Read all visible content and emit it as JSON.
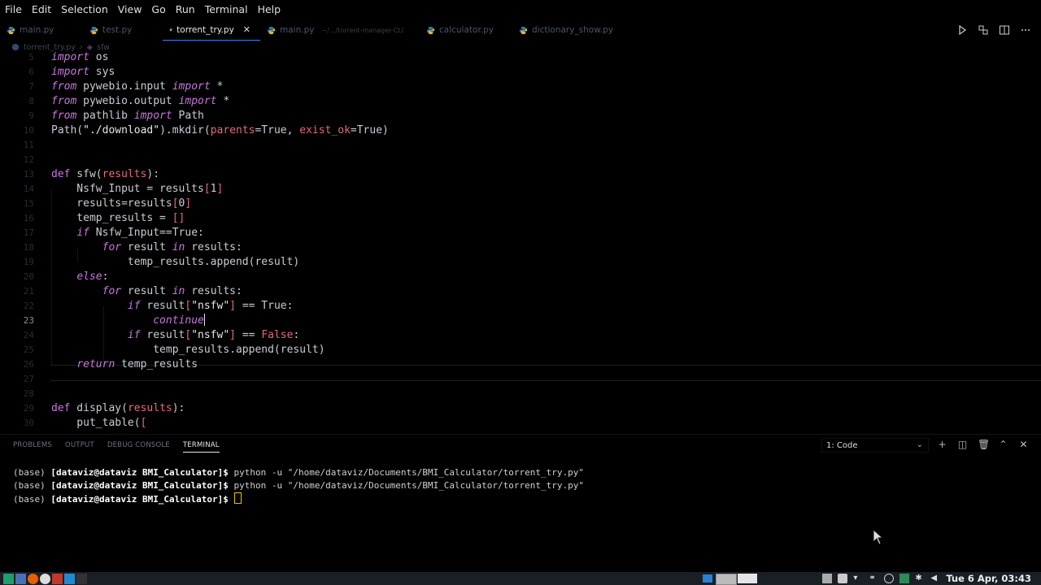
{
  "menu": [
    "File",
    "Edit",
    "Selection",
    "View",
    "Go",
    "Run",
    "Terminal",
    "Help"
  ],
  "tabs": [
    {
      "label": "main.py",
      "desc": "",
      "active": false
    },
    {
      "label": "test.py",
      "desc": "",
      "active": false
    },
    {
      "label": "torrent_try.py",
      "desc": "",
      "active": true
    },
    {
      "label": "main.py",
      "desc": "~/.../torrent-manager-CLI",
      "active": false
    },
    {
      "label": "calculator.py",
      "desc": "",
      "active": false
    },
    {
      "label": "dictionary_show.py",
      "desc": "",
      "active": false
    }
  ],
  "breadcrumb": {
    "file": "torrent_try.py",
    "symbol": "sfw"
  },
  "editor": {
    "current_line": "23",
    "line_numbers": [
      "5",
      "6",
      "7",
      "8",
      "9",
      "10",
      "11",
      "12",
      "13",
      "14",
      "15",
      "16",
      "17",
      "18",
      "19",
      "20",
      "21",
      "22",
      "23",
      "24",
      "25",
      "26",
      "27",
      "28",
      "29",
      "30"
    ]
  },
  "panel": {
    "tabs": [
      "PROBLEMS",
      "OUTPUT",
      "DEBUG CONSOLE",
      "TERMINAL"
    ],
    "active_tab": "TERMINAL",
    "terminal_select": "1: Code",
    "lines": [
      {
        "prefix": "(base) ",
        "prompt": "[dataviz@dataviz BMI_Calculator]$",
        "cmd": " python -u \"/home/dataviz/Documents/BMI_Calculator/torrent_try.py\""
      },
      {
        "prefix": "(base) ",
        "prompt": "[dataviz@dataviz BMI_Calculator]$",
        "cmd": " python -u \"/home/dataviz/Documents/BMI_Calculator/torrent_try.py\""
      },
      {
        "prefix": "(base) ",
        "prompt": "[dataviz@dataviz BMI_Calculator]$",
        "cmd": " "
      }
    ]
  },
  "taskbar": {
    "clock": "Tue 6 Apr, 03:43"
  },
  "colors": {
    "keyword": "#c678dd",
    "param": "#e06c75",
    "accent": "#3b82f6"
  }
}
